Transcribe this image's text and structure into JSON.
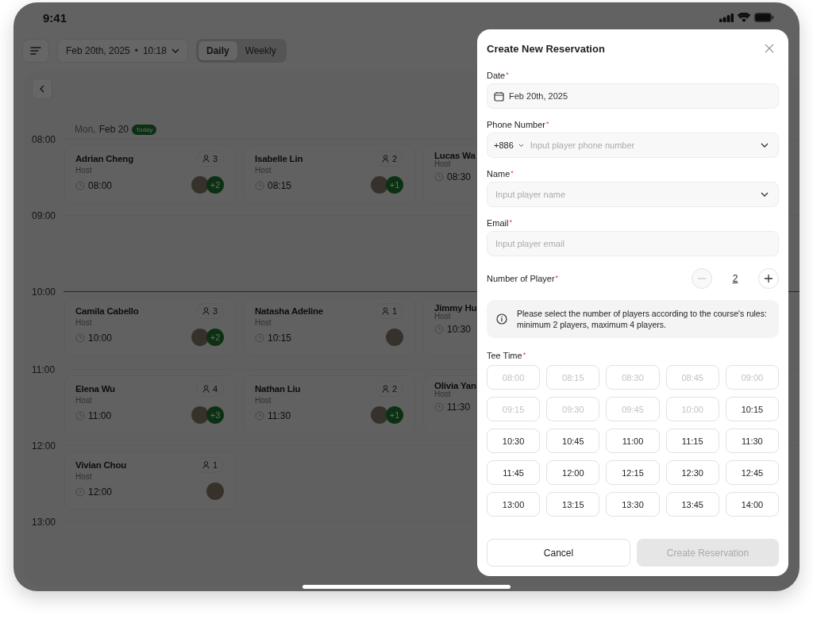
{
  "status_bar": {
    "time": "9:41"
  },
  "toolbar": {
    "date": "Feb 20th, 2025",
    "separator": "•",
    "time": "10:18",
    "views": [
      {
        "label": "Daily",
        "selected": true
      },
      {
        "label": "Weekly",
        "selected": false
      }
    ]
  },
  "calendar": {
    "weekday": "Mon,",
    "date": "Feb 20",
    "today_badge": "Today",
    "hours": [
      {
        "label": "08:00",
        "current": false,
        "cards": [
          {
            "name": "Adrian Cheng",
            "role": "Host",
            "time": "08:00",
            "players": "3",
            "extra": "+2"
          },
          {
            "name": "Isabelle Lin",
            "role": "Host",
            "time": "08:15",
            "players": "2",
            "extra": "+1"
          },
          {
            "name": "Lucas Wa",
            "role": "Host",
            "time": "08:30"
          }
        ]
      },
      {
        "label": "09:00",
        "current": false
      },
      {
        "label": "10:00",
        "current": true,
        "cards": [
          {
            "name": "Camila Cabello",
            "role": "Host",
            "time": "10:00",
            "players": "3",
            "extra": "+2"
          },
          {
            "name": "Natasha Adeline",
            "role": "Host",
            "time": "10:15",
            "players": "1"
          },
          {
            "name": "Jimmy Hu",
            "role": "Host",
            "time": "10:30"
          }
        ]
      },
      {
        "label": "11:00",
        "current": false,
        "cards": [
          {
            "name": "Elena Wu",
            "role": "Host",
            "time": "11:00",
            "players": "4",
            "extra": "+3"
          },
          {
            "name": "Nathan Liu",
            "role": "Host",
            "time": "11:30",
            "players": "2",
            "extra": "+1"
          },
          {
            "name": "Olivia Yan",
            "role": "Host",
            "time": "11:30"
          }
        ]
      },
      {
        "label": "12:00",
        "current": false,
        "cards": [
          {
            "name": "Vivian Chou",
            "role": "Host",
            "time": "12:00",
            "players": "1"
          }
        ]
      },
      {
        "label": "13:00",
        "current": false
      }
    ]
  },
  "modal": {
    "title": "Create New Reservation",
    "fields": [
      {
        "kind": "date",
        "label": "Date",
        "required_mark": "*",
        "value": "Feb 20th, 2025"
      },
      {
        "kind": "phone",
        "label": "Phone Number",
        "required_mark": "*",
        "country_code": "+886",
        "placeholder": "Input player phone number"
      },
      {
        "kind": "select",
        "label": "Name",
        "required_mark": "*",
        "placeholder": "Input player name"
      },
      {
        "kind": "text",
        "label": "Email",
        "required_mark": "*",
        "placeholder": "Input player email"
      }
    ],
    "players": {
      "label": "Number of Player",
      "required_mark": "*",
      "value": "2",
      "minus_disabled": true,
      "plus_disabled": false
    },
    "note": "Please select the number of players according to the course's rules: minimum 2 players, maximum 4 players.",
    "tee_time": {
      "label": "Tee Time",
      "required_mark": "*",
      "slots": [
        {
          "time": "08:00",
          "disabled": true
        },
        {
          "time": "08:15",
          "disabled": true
        },
        {
          "time": "08:30",
          "disabled": true
        },
        {
          "time": "08:45",
          "disabled": true
        },
        {
          "time": "09:00",
          "disabled": true
        },
        {
          "time": "09:15",
          "disabled": true
        },
        {
          "time": "09:30",
          "disabled": true
        },
        {
          "time": "09:45",
          "disabled": true
        },
        {
          "time": "10:00",
          "disabled": true
        },
        {
          "time": "10:15",
          "disabled": false
        },
        {
          "time": "10:30",
          "disabled": false
        },
        {
          "time": "10:45",
          "disabled": false
        },
        {
          "time": "11:00",
          "disabled": false
        },
        {
          "time": "11:15",
          "disabled": false
        },
        {
          "time": "11:30",
          "disabled": false
        },
        {
          "time": "11:45",
          "disabled": false
        },
        {
          "time": "12:00",
          "disabled": false
        },
        {
          "time": "12:15",
          "disabled": false
        },
        {
          "time": "12:30",
          "disabled": false
        },
        {
          "time": "12:45",
          "disabled": false
        },
        {
          "time": "13:00",
          "disabled": false
        },
        {
          "time": "13:15",
          "disabled": false
        },
        {
          "time": "13:30",
          "disabled": false
        },
        {
          "time": "13:45",
          "disabled": false
        },
        {
          "time": "14:00",
          "disabled": false
        }
      ]
    },
    "cancel": "Cancel",
    "submit": {
      "label": "Create Reservation",
      "disabled": true
    }
  }
}
